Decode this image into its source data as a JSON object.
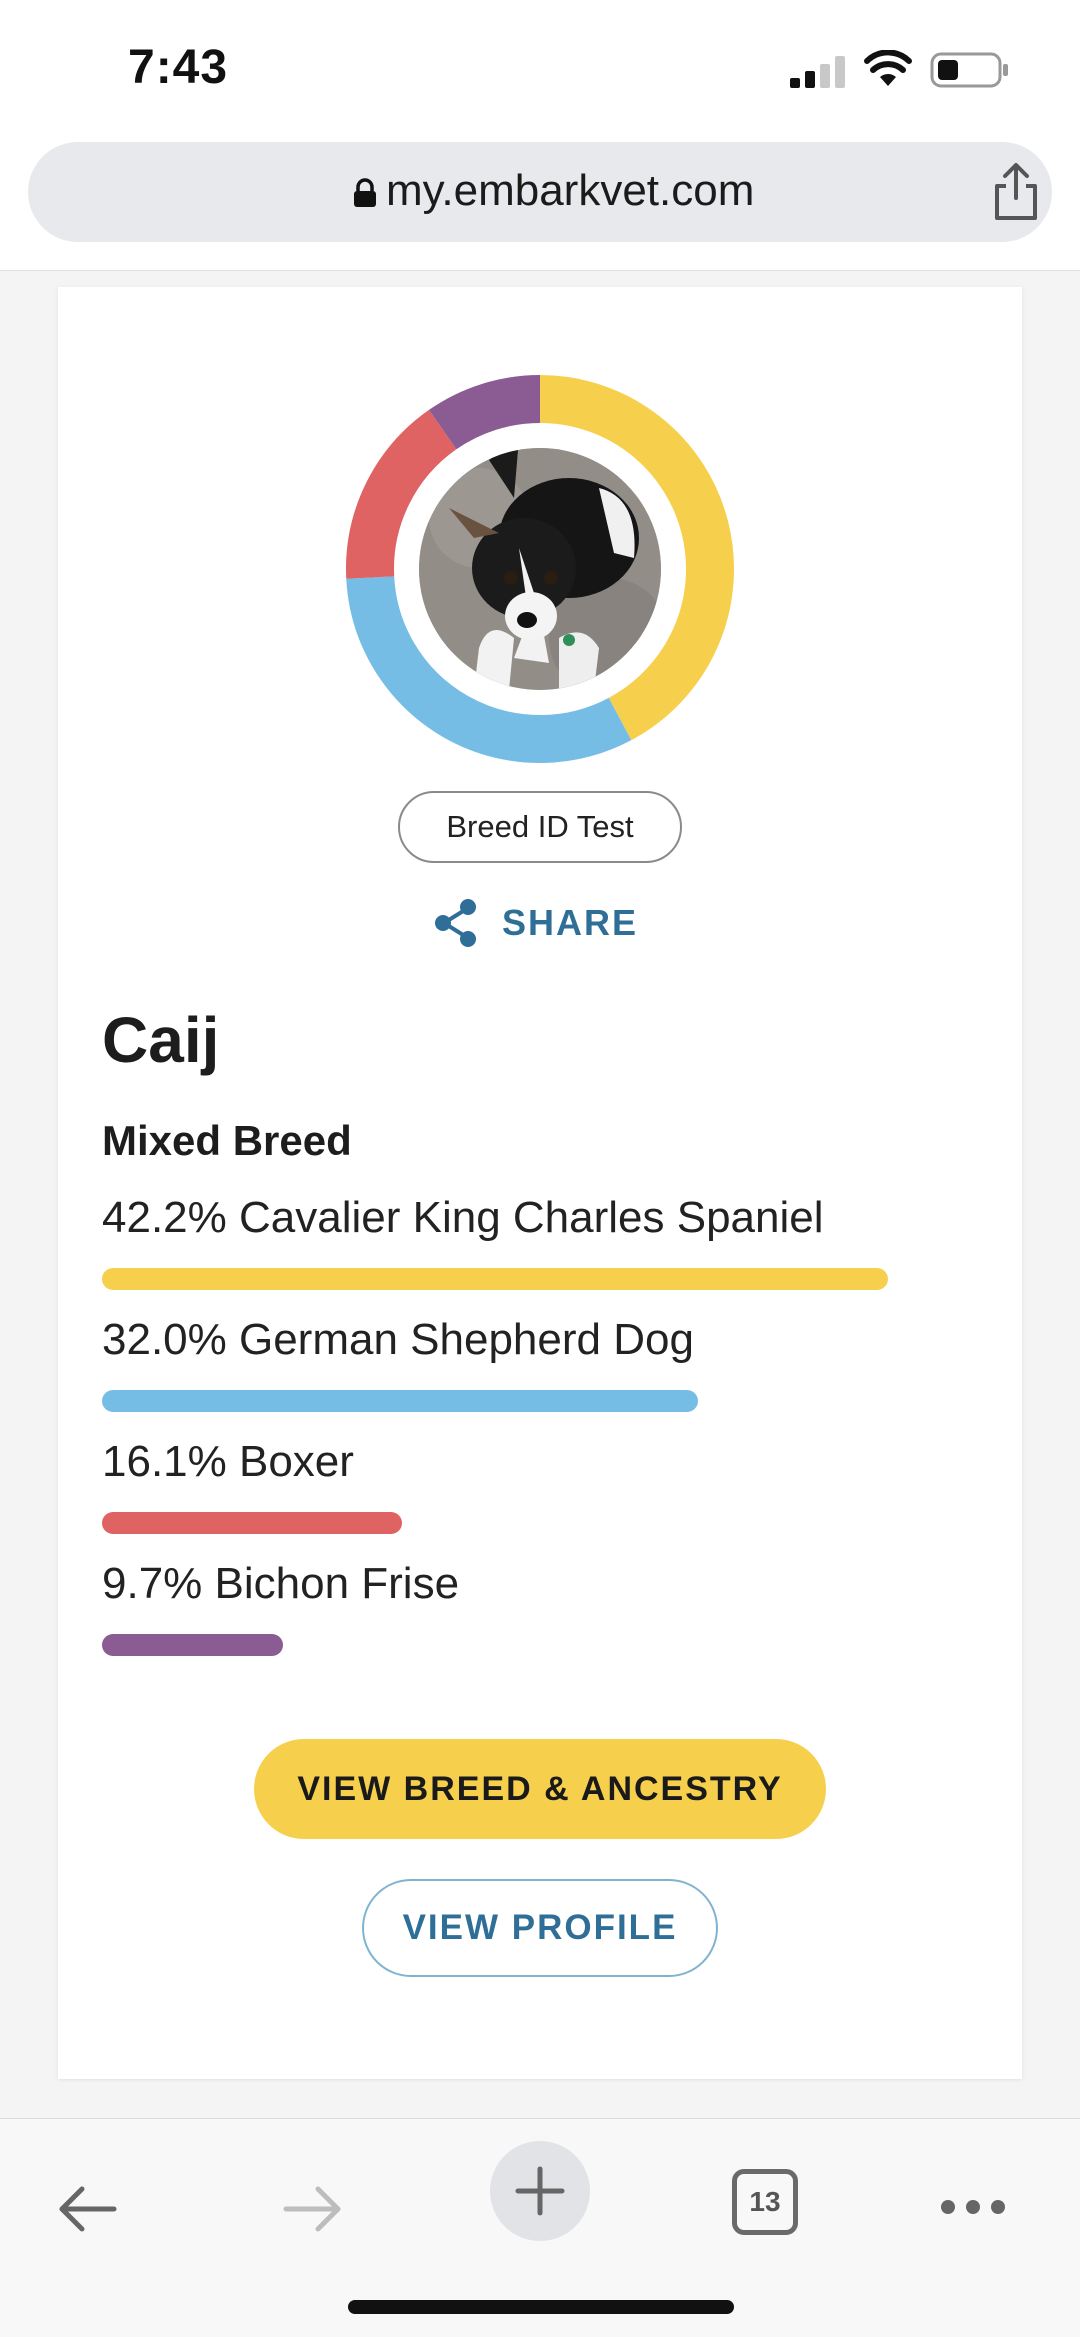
{
  "status_bar": {
    "time": "7:43"
  },
  "browser": {
    "url": "my.embarkvet.com",
    "tab_count": "13",
    "icons": [
      "lock-icon",
      "share-icon",
      "back-arrow-icon",
      "forward-arrow-icon",
      "plus-icon",
      "tabs-icon",
      "more-icon"
    ]
  },
  "profile": {
    "test_label": "Breed ID Test",
    "share_label": "SHARE",
    "dog_name": "Caij",
    "mix_label": "Mixed Breed"
  },
  "breeds": [
    {
      "label": "42.2% Cavalier King Charles Spaniel",
      "percent": 42.2,
      "color": "#f6d04d"
    },
    {
      "label": "32.0% German Shepherd Dog",
      "percent": 32.0,
      "color": "#76bde6"
    },
    {
      "label": "16.1% Boxer",
      "percent": 16.1,
      "color": "#e06363"
    },
    {
      "label": "9.7% Bichon Frise",
      "percent": 9.7,
      "color": "#8a5c93"
    }
  ],
  "buttons": {
    "primary": "VIEW BREED & ANCESTRY",
    "secondary": "VIEW PROFILE"
  },
  "colors": {
    "accent_blue": "#2f6f97",
    "cta_yellow": "#f6d04d"
  }
}
